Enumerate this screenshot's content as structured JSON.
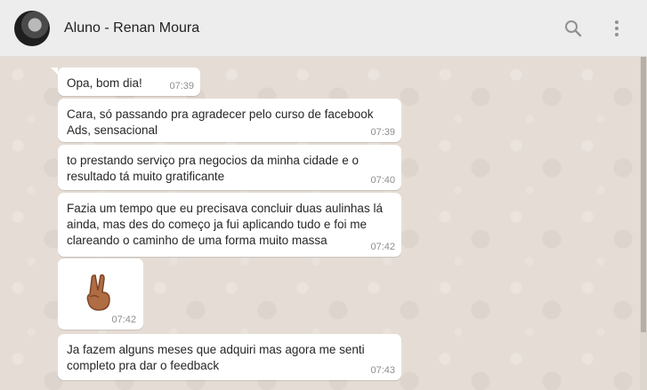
{
  "header": {
    "contact_name": "Aluno - Renan Moura",
    "icons": [
      "search-icon",
      "menu-dots-icon"
    ]
  },
  "messages": [
    {
      "text": "Opa, bom dia!",
      "time": "07:39"
    },
    {
      "text": "Cara, só passando pra agradecer pelo curso de facebook Ads, sensacional",
      "time": "07:39"
    },
    {
      "text": "to prestando serviço pra negocios da minha cidade e o resultado tá muito gratificante",
      "time": "07:40"
    },
    {
      "text": "Fazia um tempo que eu precisava concluir duas aulinhas lá ainda, mas des do começo ja fui aplicando tudo e foi me clareando o caminho de uma forma muito massa",
      "time": "07:42"
    },
    {
      "emoji": "victory-hand-emoji",
      "time": "07:42"
    },
    {
      "text": "Ja fazem alguns meses que adquiri mas agora me senti completo pra dar o feedback",
      "time": "07:43"
    }
  ]
}
